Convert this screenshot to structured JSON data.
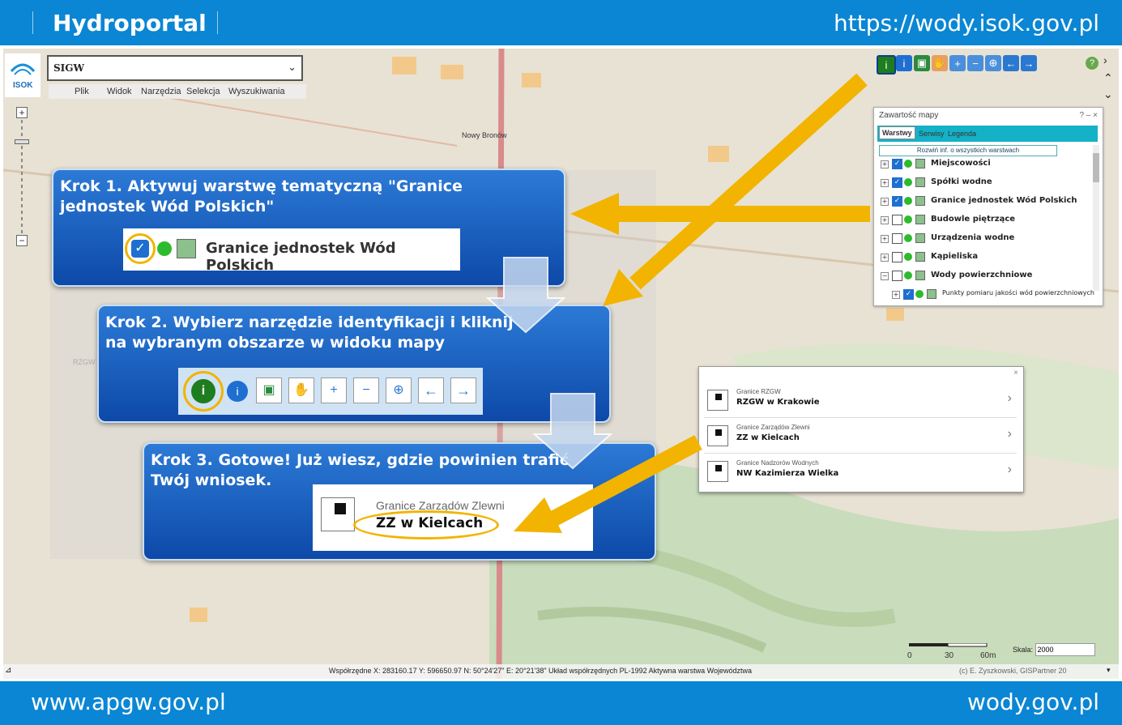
{
  "header": {
    "brand": "Hydroportal",
    "url": "https://wody.isok.gov.pl"
  },
  "footer": {
    "left": "www.apgw.gov.pl",
    "right": "wody.gov.pl"
  },
  "app": {
    "logo_text": "ISOK",
    "service_select": "SIGW",
    "menu": [
      "Plik",
      "Widok",
      "Narzędzia",
      "Selekcja",
      "Wyszukiwania"
    ],
    "map_label": "Nowy Bronów",
    "map_label_left": "RZGW"
  },
  "toolbar_icons": [
    "identify-icon",
    "info-icon",
    "map-icon",
    "pan-hand-icon",
    "zoom-in-icon",
    "zoom-out-icon",
    "zoom-extent-icon",
    "arrow-left-icon",
    "arrow-right-icon"
  ],
  "map_content_panel": {
    "title": "Zawartość mapy",
    "controls": "? – ×",
    "tabs": [
      "Warstwy",
      "Serwisy",
      "Legenda"
    ],
    "expand_button": "Rozwiń inf. o wszystkich warstwach",
    "layers": [
      {
        "label": "Miejscowości",
        "checked": true,
        "expander": "+"
      },
      {
        "label": "Spółki wodne",
        "checked": true,
        "expander": "+"
      },
      {
        "label": "Granice jednostek Wód Polskich",
        "checked": true,
        "expander": "+"
      },
      {
        "label": "Budowle piętrzące",
        "checked": false,
        "expander": "+"
      },
      {
        "label": "Urządzenia wodne",
        "checked": false,
        "expander": "+"
      },
      {
        "label": "Kąpieliska",
        "checked": false,
        "expander": "+"
      },
      {
        "label": "Wody powierzchniowe",
        "checked": false,
        "expander": "−"
      },
      {
        "label": "Punkty pomiaru jakości wód powierzchniowych",
        "checked": true,
        "expander": "+"
      }
    ]
  },
  "identify_popup": {
    "rows": [
      {
        "small": "Granice RZGW",
        "big": "RZGW w Krakowie"
      },
      {
        "small": "Granice Zarządów Zlewni",
        "big": "ZZ w Kielcach"
      },
      {
        "small": "Granice Nadzorów Wodnych",
        "big": "NW Kazimierza Wielka"
      }
    ]
  },
  "statusbar": {
    "coords": "Współrzędne X: 283160.17 Y: 596650.97   N: 50°24'27\" E: 20°21'38\"   Układ współrzędnych PL-1992   Aktywna warstwa Województwa",
    "copyright": "(c) E. Zyszkowski, GISPartner 20"
  },
  "scale": {
    "ticks": [
      "0",
      "30",
      "60m"
    ],
    "label": "Skala:",
    "value": "2000"
  },
  "steps": [
    {
      "text_line1": "Krok 1. Aktywuj warstwę tematyczną \"Granice",
      "text_line2": "jednostek Wód Polskich\"",
      "inset": "Granice jednostek Wód Polskich"
    },
    {
      "text_line1": "Krok 2. Wybierz narzędzie identyfikacji i kliknij",
      "text_line2": "na wybranym obszarze  w widoku mapy"
    },
    {
      "text_line1": "Krok 3. Gotowe! Już wiesz, gdzie powinien trafić",
      "text_line2": "Twój wniosek.",
      "inset_small": "Granice Zarządów Zlewni",
      "inset_big": "ZZ w Kielcach"
    }
  ],
  "colors": {
    "bar": "#0a86d4",
    "step_blue": "#1a5fc4",
    "arrow_yellow": "#f2b400"
  }
}
